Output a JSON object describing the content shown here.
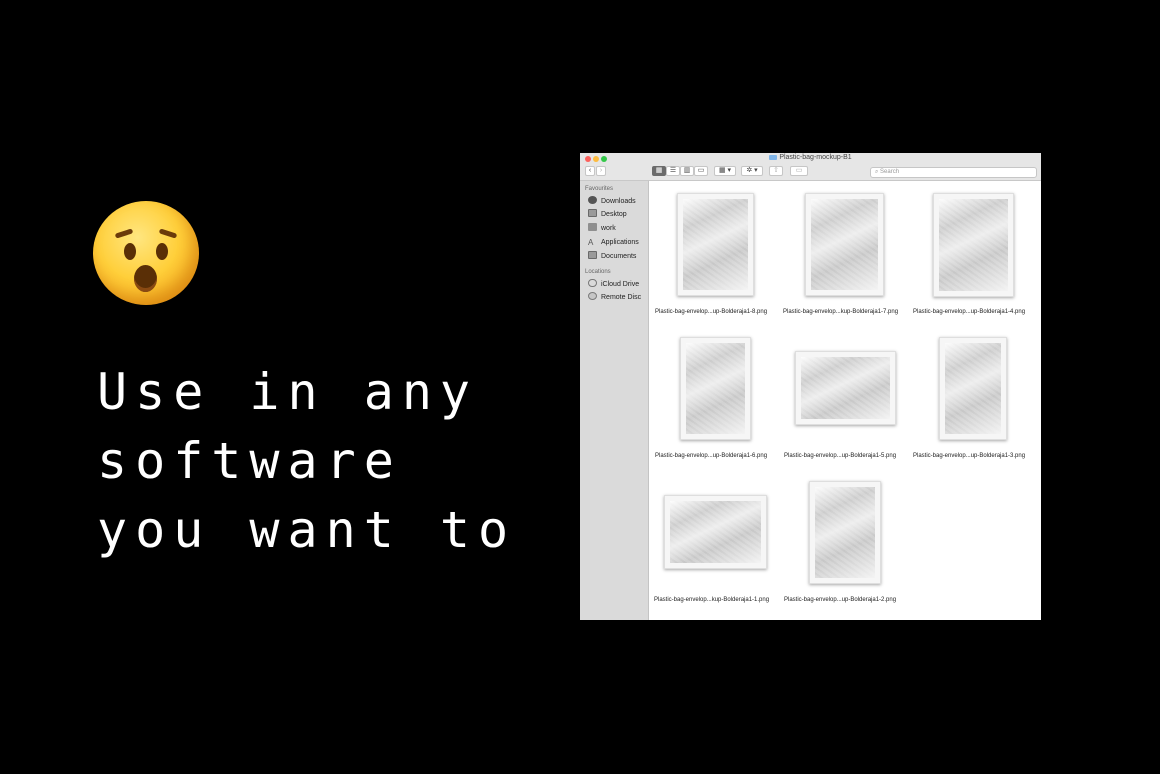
{
  "headline": {
    "line1": "Use in any",
    "line2": "software",
    "line3": "you want to"
  },
  "emoji": "astonished-face",
  "finder": {
    "title": "Plastic-bag-mockup-B1",
    "search_placeholder": "Search",
    "sidebar": {
      "favourites_header": "Favourites",
      "favourites": [
        "Downloads",
        "Desktop",
        "work",
        "Applications",
        "Documents"
      ],
      "locations_header": "Locations",
      "locations": [
        "iCloud Drive",
        "Remote Disc"
      ]
    },
    "files": [
      "Plastic-bag-envelop...up-Bolderaja1-8.png",
      "Plastic-bag-envelop...kup-Bolderaja1-7.png",
      "Plastic-bag-envelop...up-Bolderaja1-4.png",
      "Plastic-bag-envelop...up-Bolderaja1-6.png",
      "Plastic-bag-envelop...up-Bolderaja1-5.png",
      "Plastic-bag-envelop...up-Bolderaja1-3.png",
      "Plastic-bag-envelop...kup-Bolderaja1-1.png",
      "Plastic-bag-envelop...up-Bolderaja1-2.png"
    ]
  },
  "colors": {
    "background": "#000000",
    "text": "#ffffff",
    "sidebar": "#dadada",
    "titlebar": "#e6e6e6"
  }
}
